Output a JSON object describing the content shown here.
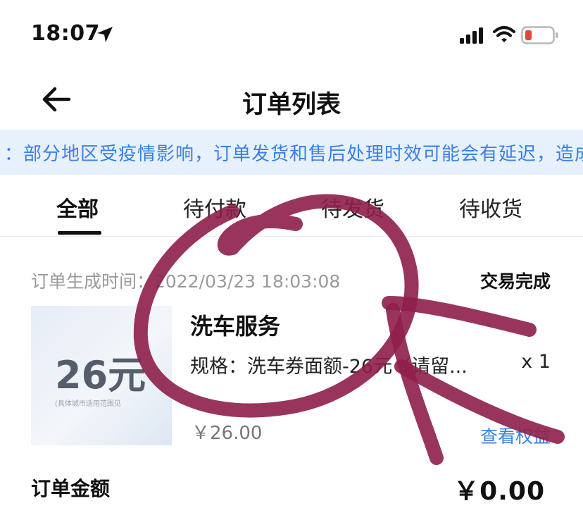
{
  "status_bar": {
    "time": "18:07"
  },
  "nav": {
    "title": "订单列表"
  },
  "notice": {
    "text": "：部分地区受疫情影响，订单发货和售后处理时效可能会有延迟，造成"
  },
  "tabs": [
    {
      "label": "全部",
      "active": true
    },
    {
      "label": "待付款",
      "active": false
    },
    {
      "label": "待发货",
      "active": false
    },
    {
      "label": "待收货",
      "active": false
    }
  ],
  "order": {
    "created_label": "订单生成时间：2022/03/23 18:03:08",
    "status": "交易完成",
    "thumbnail": {
      "value": "26元",
      "note": "(具体城市适用范围见"
    },
    "product_name": "洗车服务",
    "spec": "规格：洗车券面额-26元（请留...",
    "quantity": "x 1",
    "unit_price": "￥26.00",
    "view_link": "查看权益",
    "amount_label": "订单金额",
    "amount_value": "￥0.00"
  },
  "colors": {
    "accent": "#3a7fe8",
    "notice_bg": "#e6f1fd",
    "annotation": "#8e1f4a"
  },
  "icons": [
    "location-arrow-icon",
    "signal-icon",
    "wifi-icon",
    "battery-low-icon",
    "back-arrow-icon"
  ]
}
